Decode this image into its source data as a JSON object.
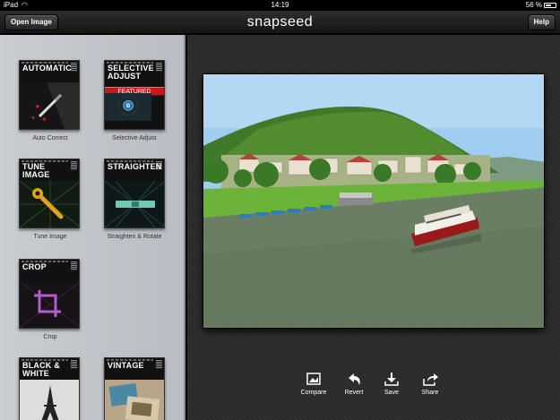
{
  "status_bar": {
    "carrier": "iPad",
    "time": "14:19",
    "battery": "56 %"
  },
  "toolbar": {
    "open_image_label": "Open Image",
    "app_logo": "snapseed",
    "help_label": "Help"
  },
  "sidebar": {
    "tools": [
      {
        "title": "AUTOMATIC",
        "label": "Auto Correct"
      },
      {
        "title": "SELECTIVE ADJUST",
        "label": "Selective Adjust",
        "badge": "FEATURED"
      },
      {
        "title": "TUNE IMAGE",
        "label": "Tune Image"
      },
      {
        "title": "STRAIGHTEN",
        "label": "Straighten & Rotate"
      },
      {
        "title": "CROP",
        "label": "Crop"
      },
      {
        "title": "BLACK & WHITE",
        "label": ""
      },
      {
        "title": "VINTAGE",
        "label": ""
      }
    ]
  },
  "bottom_bar": {
    "compare_label": "Compare",
    "revert_label": "Revert",
    "save_label": "Save",
    "share_label": "Share"
  },
  "colors": {
    "featured_red": "#c8161d",
    "sky": "#9fcdf0",
    "river": "#6a7e63"
  }
}
